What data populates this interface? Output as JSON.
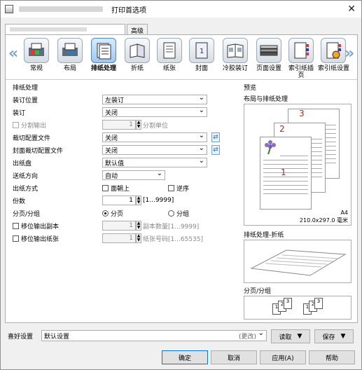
{
  "window": {
    "title": "打印首选项",
    "close_glyph": "✕"
  },
  "tabs": {
    "advanced": "高级"
  },
  "toolbar": {
    "left_arrow": "«",
    "right_arrow": "»",
    "items": [
      {
        "label": "常规",
        "icon": "general-icon"
      },
      {
        "label": "布局",
        "icon": "layout-icon"
      },
      {
        "label": "排纸处理",
        "icon": "finishing-icon"
      },
      {
        "label": "折纸",
        "icon": "fold-icon"
      },
      {
        "label": "纸张",
        "icon": "paper-icon"
      },
      {
        "label": "封面",
        "icon": "cover-icon"
      },
      {
        "label": "冷胶装订",
        "icon": "perfect-bind-icon"
      },
      {
        "label": "页面设置",
        "icon": "page-setup-icon"
      },
      {
        "label": "索引纸插页",
        "icon": "tab-insert-icon"
      },
      {
        "label": "索引纸设置",
        "icon": "tab-settings-icon"
      }
    ]
  },
  "section": {
    "title": "排纸处理",
    "preview": "预览"
  },
  "settings": {
    "binding_position": {
      "label": "装订位置",
      "value": "左装订"
    },
    "staple": {
      "label": "装订",
      "value": "关闭"
    },
    "split": {
      "label": "分割输出",
      "value": "1",
      "unit": "分割单位"
    },
    "trim_profile": {
      "label": "裁切配置文件",
      "value": "关闭"
    },
    "cover_trim": {
      "label": "封面裁切配置文件",
      "value": "关闭"
    },
    "output_tray": {
      "label": "出纸盘",
      "value": "默认值"
    },
    "feed_dir": {
      "label": "送纸方向",
      "value": "自动"
    },
    "output_method": {
      "label": "出纸方式",
      "opt1": "面朝上",
      "opt2": "逆序"
    },
    "copies": {
      "label": "份数",
      "value": "1",
      "range": "[1...9999]"
    },
    "sort": {
      "label": "分页/分组",
      "opt1": "分页",
      "opt2": "分组"
    },
    "offset_copies": {
      "label": "移位输出副本",
      "value": "1",
      "unit": "副本数量[1...9999]"
    },
    "offset_sheets": {
      "label": "移位输出纸张",
      "value": "1",
      "unit": "纸张号码[1...65535]"
    }
  },
  "preview": {
    "layout_title": "布局与排纸处理",
    "page_numbers": [
      "1",
      "2",
      "3"
    ],
    "paper_size": "A4",
    "paper_dims": "210.0x297.0 毫米",
    "fold_title": "排纸处理-折纸",
    "sort_title": "分页/分组",
    "sort_marks": [
      "1",
      "2",
      "3",
      "1",
      "2",
      "3"
    ]
  },
  "footer": {
    "fav_label": "喜好设置",
    "fav_value": "默认设置",
    "changed": "(更改)",
    "load": "读取",
    "save": "保存",
    "ok": "确定",
    "cancel": "取消",
    "apply": "应用(A)",
    "help": "帮助"
  }
}
